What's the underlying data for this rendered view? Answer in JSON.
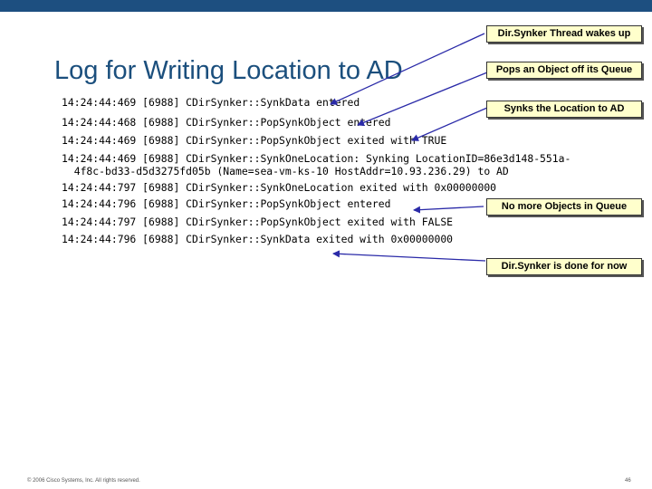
{
  "title": "Log for Writing Location to AD",
  "log_lines": [
    "14:24:44:469 [6988] CDirSynker::SynkData entered",
    "14:24:44:468 [6988] CDirSynker::PopSynkObject entered",
    "14:24:44:469 [6988] CDirSynker::PopSynkObject exited with TRUE",
    "14:24:44:469 [6988] CDirSynker::SynkOneLocation: Synking LocationID=86e3d148-551a-",
    "  4f8c-bd33-d5d3275fd05b (Name=sea-vm-ks-10 HostAddr=10.93.236.29) to AD",
    "14:24:44:797 [6988] CDirSynker::SynkOneLocation exited with 0x00000000",
    "14:24:44:796 [6988] CDirSynker::PopSynkObject entered",
    "14:24:44:797 [6988] CDirSynker::PopSynkObject exited with FALSE",
    "14:24:44:796 [6988] CDirSynker::SynkData exited with 0x00000000"
  ],
  "callouts": {
    "wakes_up": "Dir.Synker Thread wakes up",
    "pops_object": "Pops an Object off its Queue",
    "synks_location": "Synks the Location to AD",
    "no_more_objects": "No more Objects in Queue",
    "done": "Dir.Synker is done for now"
  },
  "footer": {
    "copyright": "© 2006 Cisco Systems, Inc. All rights reserved.",
    "page_number": "46"
  },
  "colors": {
    "top_bar": "#1d4f80",
    "title": "#1b4f7d",
    "callout_fill": "#ffffcc",
    "arrow": "#2a2aa8"
  }
}
